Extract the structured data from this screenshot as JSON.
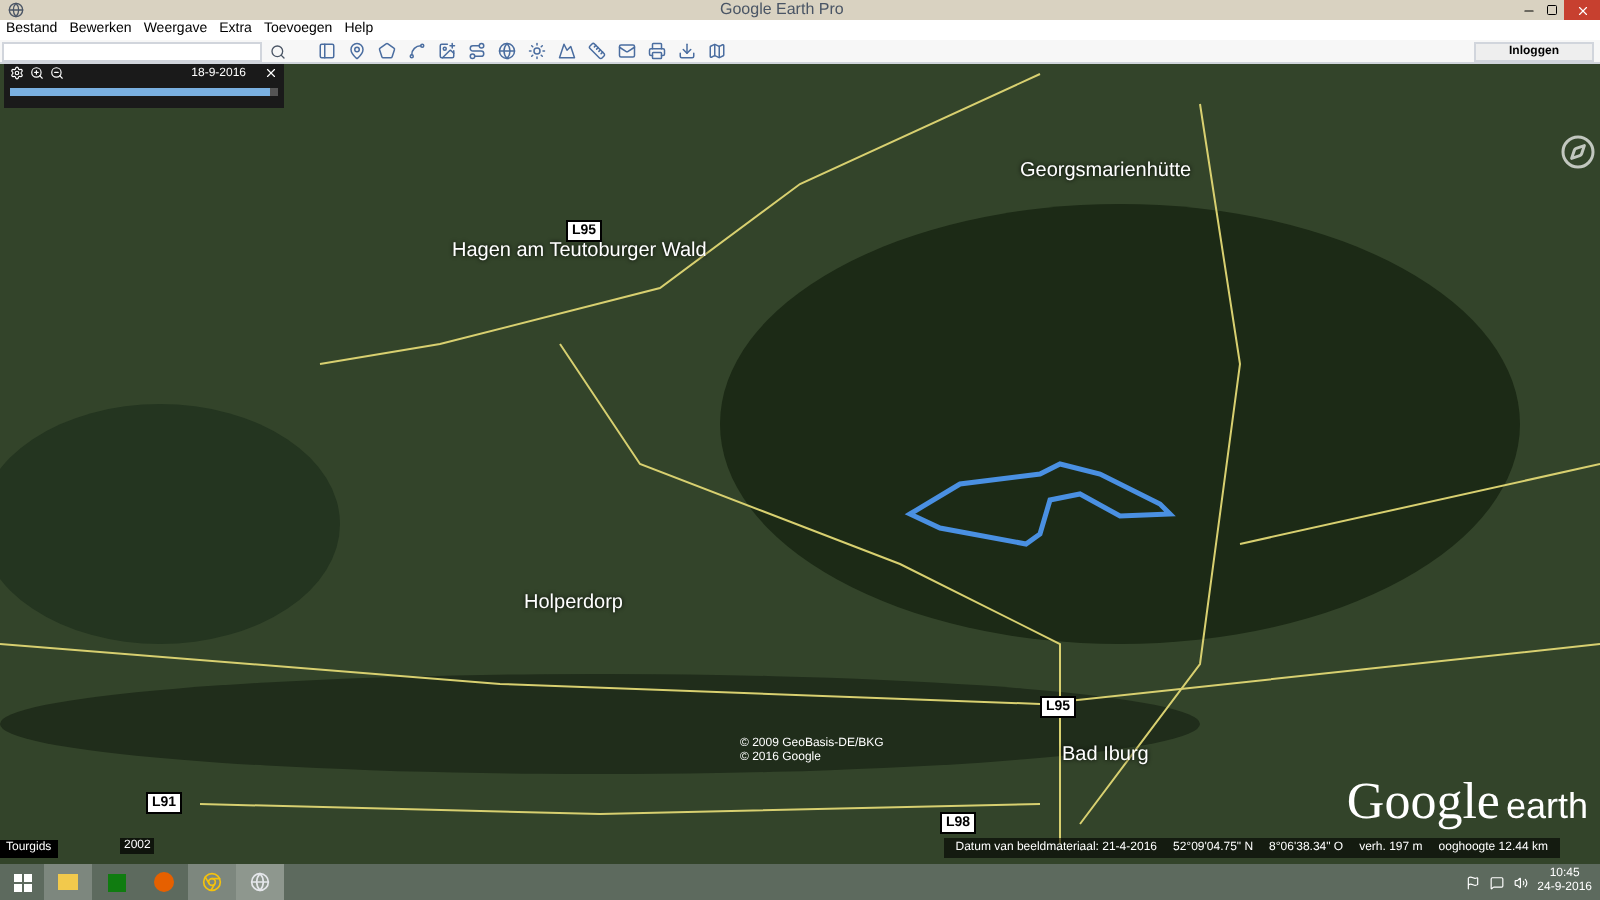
{
  "window": {
    "title": "Google Earth Pro"
  },
  "menu": [
    "Bestand",
    "Bewerken",
    "Weergave",
    "Extra",
    "Toevoegen",
    "Help"
  ],
  "signin": "Inloggen",
  "time_slider": {
    "date": "18-9-2016",
    "level": 0.97
  },
  "map_labels": [
    {
      "kind": "place",
      "text": "Georgsmarienhütte"
    },
    {
      "kind": "place",
      "text": "Hagen am Teutoburger Wald"
    },
    {
      "kind": "place",
      "text": "Holperdorp"
    },
    {
      "kind": "place",
      "text": "Bad Iburg"
    },
    {
      "kind": "road",
      "text": "L95"
    },
    {
      "kind": "road",
      "text": "L98"
    },
    {
      "kind": "road",
      "text": "L91"
    },
    {
      "kind": "road",
      "text": "L95"
    }
  ],
  "copyright": [
    "© 2009 GeoBasis-DE/BKG",
    "© 2016 Google"
  ],
  "logo": {
    "word1": "Google",
    "word2": "earth"
  },
  "tour_guide": "Tourgids",
  "year": "2002",
  "status": [
    "Datum van beeldmateriaal: 21-4-2016",
    "52°09'04.75\" N",
    "8°06'38.34\" O",
    "verh. 197 m",
    "ooghoogte 12.44 km"
  ],
  "clock": {
    "time": "10:45",
    "date": "24-9-2016"
  }
}
